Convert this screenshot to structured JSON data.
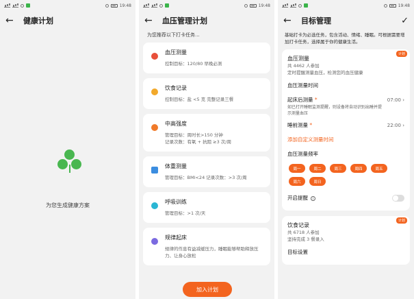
{
  "statusbar": {
    "time": "19:48"
  },
  "screen1": {
    "title": "健康计划",
    "caption": "为您生成健康方案"
  },
  "screen2": {
    "title": "血压管理计划",
    "subtitle": "为您推荐以下打卡任务...",
    "tasks": [
      {
        "name": "血压测量",
        "desc": "控制目标：120/80  早晚必测",
        "icon": "blood-drop-icon",
        "color": "#e8503a"
      },
      {
        "name": "饮食记录",
        "desc": "控制目标：盐 <5 克  完整记录三餐",
        "icon": "bowl-icon",
        "color": "#f2a92b"
      },
      {
        "name": "中高强度",
        "desc": "管理目标：周时长>150 分钟",
        "desc2": "记录次数：有氧 + 抗阻 ≥3 次/周",
        "icon": "flame-icon",
        "color": "#f07a2a"
      },
      {
        "name": "体重测量",
        "desc": "管理目标：BMI<24  记录次数：>3 次/周",
        "icon": "scale-icon",
        "color": "#3b8de0"
      },
      {
        "name": "呼吸训练",
        "desc": "管理目标：>1 次/天",
        "icon": "breath-icon",
        "color": "#2ab6d4"
      },
      {
        "name": "规律起床",
        "desc": "规律的作息有益减缓压力，睡眠能够帮助释放压力、让身心放松",
        "icon": "moon-icon",
        "color": "#7b6ae0"
      }
    ],
    "join_button": "加入计划"
  },
  "screen3": {
    "title": "目标管理",
    "intro": "基础打卡为必选任务，包含活动、情绪、睡眠。可根据需要增加打卡任务，选择属于你的健康生活。",
    "card1": {
      "tag": "计划",
      "title": "血压测量",
      "participants": "共 4462 人参加",
      "desc": "定时提醒测量血压，检测您的血压健康",
      "section": "血压测量时间",
      "wake_label": "起床后测量",
      "wake_value": "07:00",
      "wake_desc": "如已打开睡眠监测提醒，则设备将自动识别出睡并提示测量血压",
      "sleep_label": "睡前测量",
      "sleep_value": "22:00",
      "add_custom": "添加自定义测量时间",
      "freq_label": "血压测量频率",
      "days": [
        "周一",
        "周二",
        "周三",
        "周四",
        "周五",
        "周六",
        "周日"
      ],
      "reminder_label": "开启提醒"
    },
    "card2": {
      "tag": "计划",
      "title": "饮食记录",
      "participants": "共 6718 人参加",
      "desc": "坚持完成 3 餐录入",
      "goal": "目标设置"
    }
  }
}
